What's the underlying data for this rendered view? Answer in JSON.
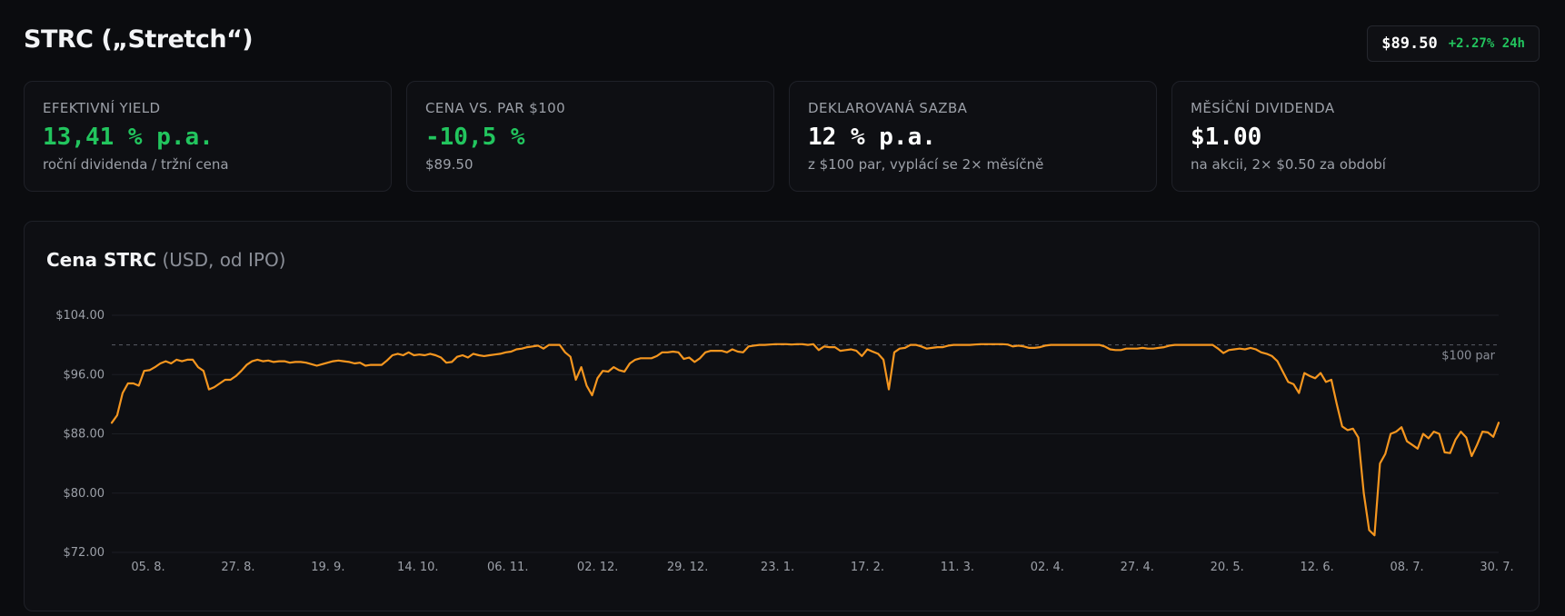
{
  "header": {
    "title": "STRC („Stretch“)",
    "price": "$89.50",
    "change": "+2.27% 24h"
  },
  "cards": [
    {
      "label": "Efektivní yield",
      "value": "13,41 % p.a.",
      "sub": "roční dividenda / tržní cena"
    },
    {
      "label": "Cena vs. par $100",
      "value": "-10,5 %",
      "sub": "$89.50"
    },
    {
      "label": "Deklarovaná sazba",
      "value": "12 % p.a.",
      "sub": "z $100 par, vyplácí se 2× měsíčně"
    },
    {
      "label": "Měsíční dividenda",
      "value": "$1.00",
      "sub": "na akcii, 2× $0.50 za období"
    }
  ],
  "colors": {
    "accent_line": "#f5961f",
    "positive": "#22c55e",
    "background": "#0b0c0f",
    "card_background": "#0e0f13"
  },
  "chart_title": {
    "main": "Cena STRC",
    "muted": "(USD, od IPO)"
  },
  "chart_data": {
    "type": "line",
    "title": "Cena STRC (USD, od IPO)",
    "ylim": [
      72,
      104
    ],
    "y_ticks": [
      "$104.00",
      "$96.00",
      "$88.00",
      "$80.00",
      "$72.00"
    ],
    "y_tick_values": [
      104,
      96,
      88,
      80,
      72
    ],
    "x_ticks": [
      "05. 8.",
      "27. 8.",
      "19. 9.",
      "14. 10.",
      "06. 11.",
      "02. 12.",
      "29. 12.",
      "23. 1.",
      "17. 2.",
      "11. 3.",
      "02. 4.",
      "27. 4.",
      "20. 5.",
      "12. 6.",
      "08. 7.",
      "30. 7."
    ],
    "reference_line": {
      "value": 100,
      "label": "$100 par"
    },
    "grid": true,
    "series": [
      {
        "values": [
          89.5,
          90.5,
          93.5,
          94.8,
          94.8,
          94.5,
          96.5,
          96.6,
          97.0,
          97.5,
          97.8,
          97.5,
          98.0,
          97.8,
          98.0,
          98.0,
          97.0,
          96.5,
          94.0,
          94.3,
          94.8,
          95.3,
          95.3,
          95.8,
          96.5,
          97.3,
          97.8,
          98.0,
          97.8,
          97.9,
          97.7,
          97.8,
          97.8,
          97.6,
          97.7,
          97.7,
          97.6,
          97.4,
          97.2,
          97.4,
          97.6,
          97.8,
          97.9,
          97.8,
          97.7,
          97.5,
          97.6,
          97.2,
          97.3,
          97.3,
          97.3,
          97.9,
          98.6,
          98.8,
          98.6,
          99.0,
          98.6,
          98.7,
          98.6,
          98.8,
          98.6,
          98.3,
          97.6,
          97.7,
          98.4,
          98.6,
          98.3,
          98.8,
          98.6,
          98.5,
          98.6,
          98.7,
          98.8,
          99.0,
          99.1,
          99.4,
          99.5,
          99.7,
          99.8,
          99.9,
          99.5,
          100.0,
          100.0,
          100.0,
          99.0,
          98.4,
          95.3,
          97.0,
          94.5,
          93.2,
          95.5,
          96.5,
          96.4,
          97.0,
          96.6,
          96.4,
          97.5,
          98.0,
          98.2,
          98.2,
          98.2,
          98.5,
          99.0,
          99.0,
          99.1,
          99.0,
          98.1,
          98.3,
          97.7,
          98.2,
          99.0,
          99.2,
          99.2,
          99.2,
          99.0,
          99.4,
          99.1,
          99.0,
          99.8,
          99.9,
          100.0,
          100.0,
          100.05,
          100.1,
          100.1,
          100.1,
          100.05,
          100.1,
          100.1,
          100.0,
          100.1,
          99.3,
          99.8,
          99.7,
          99.7,
          99.2,
          99.3,
          99.4,
          99.2,
          98.5,
          99.4,
          99.1,
          98.8,
          98.0,
          94.0,
          99.0,
          99.5,
          99.6,
          100.0,
          100.0,
          99.8,
          99.5,
          99.6,
          99.7,
          99.7,
          99.9,
          100.0,
          100.0,
          100.0,
          100.0,
          100.05,
          100.1,
          100.1,
          100.1,
          100.1,
          100.1,
          100.05,
          99.8,
          99.9,
          99.8,
          99.6,
          99.6,
          99.7,
          99.9,
          100.0,
          100.0,
          100.0,
          100.0,
          100.0,
          100.0,
          100.0,
          100.0,
          100.0,
          100.0,
          99.8,
          99.4,
          99.3,
          99.3,
          99.5,
          99.5,
          99.5,
          99.6,
          99.5,
          99.5,
          99.6,
          99.7,
          99.9,
          100.0,
          100.0,
          100.0,
          100.0,
          100.0,
          100.0,
          100.0,
          100.0,
          99.5,
          98.9,
          99.3,
          99.4,
          99.5,
          99.4,
          99.6,
          99.4,
          99.0,
          98.8,
          98.5,
          97.8,
          96.4,
          95.0,
          94.7,
          93.5,
          96.2,
          95.8,
          95.5,
          96.2,
          95.0,
          95.3,
          92.0,
          89.0,
          88.5,
          88.7,
          87.5,
          80.0,
          75.0,
          74.3,
          84.0,
          85.3,
          88.0,
          88.3,
          88.9,
          87.0,
          86.5,
          86.0,
          88.0,
          87.4,
          88.3,
          88.0,
          85.5,
          85.4,
          87.2,
          88.3,
          87.5,
          85.0,
          86.5,
          88.3,
          88.2,
          87.6,
          89.5
        ]
      }
    ]
  }
}
